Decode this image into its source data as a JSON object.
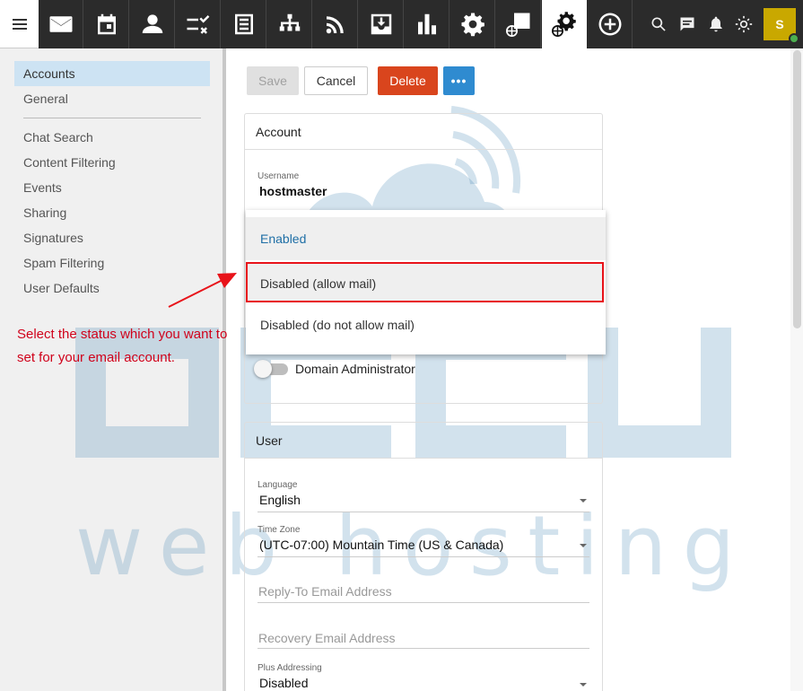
{
  "toolbar": {
    "menu_icon": "hamburger-icon",
    "apps": [
      {
        "name": "mail-icon"
      },
      {
        "name": "calendar-icon"
      },
      {
        "name": "contacts-icon"
      },
      {
        "name": "tasks-icon"
      },
      {
        "name": "notes-icon"
      },
      {
        "name": "organization-icon"
      },
      {
        "name": "rss-icon"
      },
      {
        "name": "archive-icon"
      },
      {
        "name": "reports-icon"
      },
      {
        "name": "settings-icon"
      },
      {
        "name": "domain-reports-icon"
      },
      {
        "name": "domain-settings-icon"
      },
      {
        "name": "add-icon"
      }
    ],
    "right_icons": [
      "search-icon",
      "chat-icon",
      "notifications-icon",
      "theme-icon"
    ],
    "avatar_initial": "S",
    "status_color": "#4caf50"
  },
  "sidebar": {
    "items": [
      {
        "label": "Accounts",
        "selected": true
      },
      {
        "label": "General",
        "selected": false
      },
      {
        "label": "Chat Search",
        "selected": false
      },
      {
        "label": "Content Filtering",
        "selected": false
      },
      {
        "label": "Events",
        "selected": false
      },
      {
        "label": "Sharing",
        "selected": false
      },
      {
        "label": "Signatures",
        "selected": false
      },
      {
        "label": "Spam Filtering",
        "selected": false
      },
      {
        "label": "User Defaults",
        "selected": false
      }
    ]
  },
  "annotation": {
    "text": "Select the status which you want to set for your email account.",
    "color": "#d0021b"
  },
  "actions": {
    "save": "Save",
    "cancel": "Cancel",
    "delete": "Delete",
    "more": "•••"
  },
  "account_card": {
    "title": "Account",
    "username_label": "Username",
    "username_value": "hostmaster",
    "status_options": [
      "Enabled",
      "Disabled (allow mail)",
      "Disabled (do not allow mail)"
    ],
    "current_status": "Enabled",
    "highlighted_status": "Disabled (allow mail)",
    "domain_admin_label": "Domain Administrator",
    "domain_admin_on": false
  },
  "user_card": {
    "title": "User",
    "language_label": "Language",
    "language_value": "English",
    "timezone_label": "Time Zone",
    "timezone_value": "(UTC-07:00) Mountain Time (US & Canada)",
    "reply_to_placeholder": "Reply-To Email Address",
    "recovery_placeholder": "Recovery Email Address",
    "plus_label": "Plus Addressing",
    "plus_value": "Disabled"
  },
  "watermark": {
    "brand": "accu",
    "tagline": "web hosting",
    "color": "#1f6fa6"
  },
  "colors": {
    "accent": "#2f8bd0",
    "danger": "#d9451d",
    "highlight_border": "#e8131a"
  }
}
